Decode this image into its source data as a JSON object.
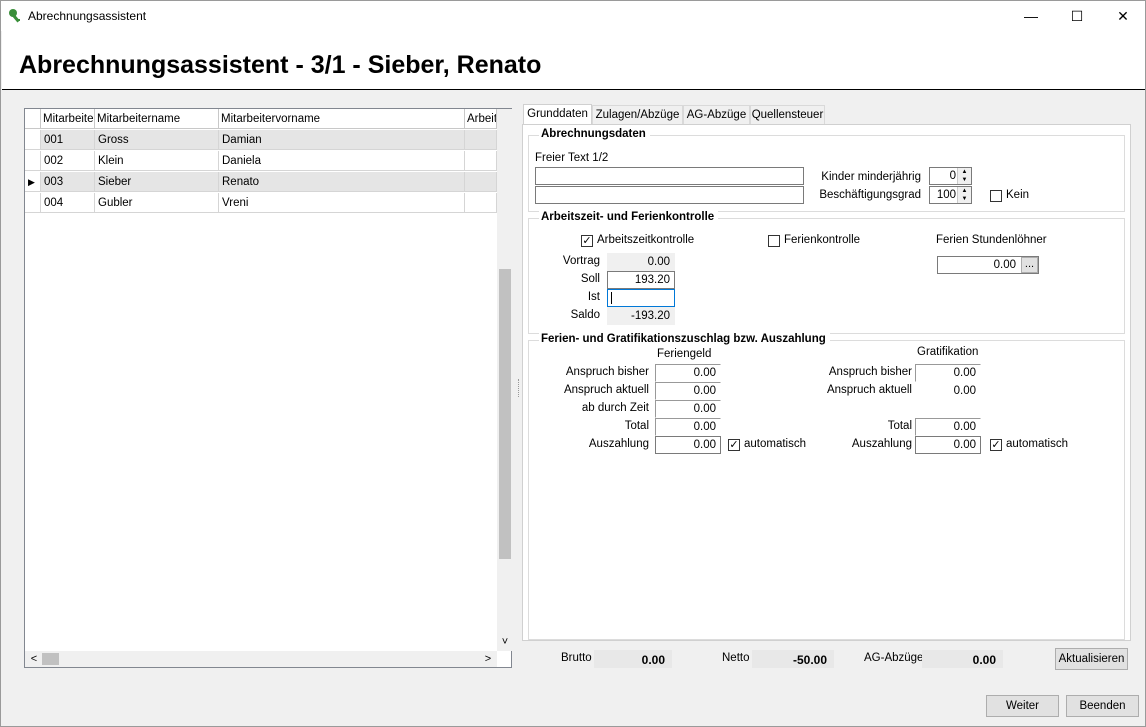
{
  "window": {
    "title": "Abrechnungsassistent",
    "controls": {
      "minimize": "—",
      "maximize": "☐",
      "close": "✕"
    }
  },
  "header": {
    "title": "Abrechnungsassistent - 3/1 - Sieber, Renato"
  },
  "grid": {
    "columns": [
      "Mitarbeiten",
      "Mitarbeitername",
      "Mitarbeitervorname",
      "Arbeits"
    ],
    "rows": [
      {
        "nr": "001",
        "name": "Gross",
        "vorname": "Damian",
        "current": false
      },
      {
        "nr": "002",
        "name": "Klein",
        "vorname": "Daniela",
        "current": false
      },
      {
        "nr": "003",
        "name": "Sieber",
        "vorname": "Renato",
        "current": true
      },
      {
        "nr": "004",
        "name": "Gubler",
        "vorname": "Vreni",
        "current": false
      }
    ],
    "row_marker": "▶"
  },
  "tabs": [
    "Grunddaten",
    "Zulagen/Abzüge",
    "AG-Abzüge",
    "Quellensteuer"
  ],
  "abrechnungsdaten": {
    "label": "Abrechnungsdaten",
    "freier_text_label": "Freier Text 1/2",
    "freier_text_1": "",
    "freier_text_2": "",
    "kinder_label": "Kinder minderjährig",
    "kinder_value": "0",
    "beschaeftigung_label": "Beschäftigungsgrad",
    "beschaeftigung_value": "100",
    "kein_label": "Kein",
    "kein_checked": false
  },
  "arbeitszeit": {
    "label": "Arbeitszeit- und Ferienkontrolle",
    "arbeitszeit_cb_label": "Arbeitszeitkontrolle",
    "arbeitszeit_checked": true,
    "ferien_cb_label": "Ferienkontrolle",
    "ferien_checked": false,
    "ferien_stunden_label": "Ferien Stundenlöhner",
    "ferien_stunden_value": "0.00",
    "ellipsis": "...",
    "vortrag_label": "Vortrag",
    "vortrag_value": "0.00",
    "soll_label": "Soll",
    "soll_value": "193.20",
    "ist_label": "Ist",
    "ist_value": "",
    "saldo_label": "Saldo",
    "saldo_value": "-193.20"
  },
  "zuschlag": {
    "label": "Ferien- und Gratifikationszuschlag bzw. Auszahlung",
    "feriengeld_header": "Feriengeld",
    "gratifikation_header": "Gratifikation",
    "anspruch_bisher_label": "Anspruch bisher",
    "anspruch_aktuell_label": "Anspruch aktuell",
    "ab_durch_zeit_label": "ab durch Zeit",
    "total_label": "Total",
    "auszahlung_label": "Auszahlung",
    "automatisch_label": "automatisch",
    "fg": {
      "anspruch_bisher": "0.00",
      "anspruch_aktuell": "0.00",
      "ab_durch_zeit": "0.00",
      "total": "0.00",
      "auszahlung": "0.00",
      "automatisch": true
    },
    "gr": {
      "anspruch_bisher": "0.00",
      "anspruch_aktuell": "0.00",
      "total": "0.00",
      "auszahlung": "0.00",
      "automatisch": true
    }
  },
  "summary": {
    "brutto_label": "Brutto",
    "brutto_value": "0.00",
    "netto_label": "Netto",
    "netto_value": "-50.00",
    "ag_label": "AG-Abzüge",
    "ag_value": "0.00",
    "aktualisieren": "Aktualisieren"
  },
  "footer": {
    "weiter": "Weiter",
    "beenden": "Beenden"
  },
  "scroll": {
    "up": "˄",
    "down": "˅",
    "left": "˂",
    "right": "˃"
  }
}
